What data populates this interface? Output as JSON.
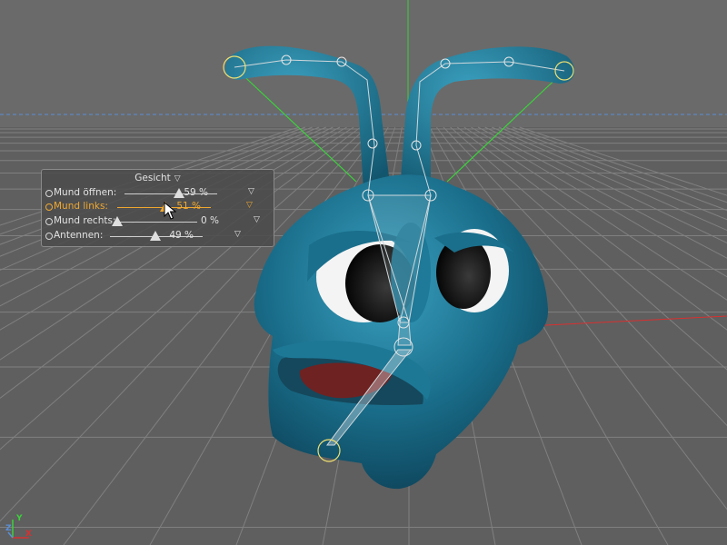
{
  "viewport": {
    "colors": {
      "background": "#6a6a6a",
      "grid": "#808080",
      "horizon_line": "#5b8fd6",
      "y_axis": "#3bd23b",
      "x_axis": "#d83030",
      "character_body": "#1a6f8c",
      "joint_highlight": "#f0e070"
    },
    "axis_gizmo": {
      "x_label": "X",
      "y_label": "Y",
      "z_label": "Z"
    }
  },
  "hud": {
    "title": "Gesicht",
    "title_icon": "dropdown-triangle-icon",
    "sliders": [
      {
        "label": "Mund öffnen:",
        "value": 59,
        "value_text": "59 %",
        "active": false
      },
      {
        "label": "Mund links:",
        "value": 51,
        "value_text": "51 %",
        "active": true
      },
      {
        "label": "Mund rechts:",
        "value": 0,
        "value_text": "0 %",
        "active": false
      },
      {
        "label": "Antennen:",
        "value": 49,
        "value_text": "49 %",
        "active": false
      }
    ],
    "colors": {
      "active": "#f0a830",
      "text": "#e2e2e2",
      "panel": "#4b4b4b"
    }
  }
}
